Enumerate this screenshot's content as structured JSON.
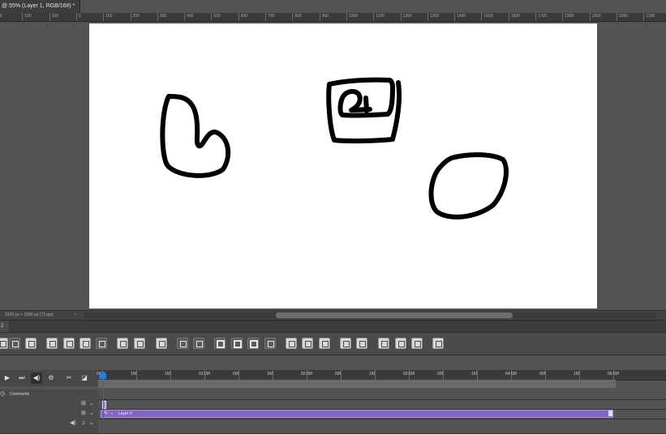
{
  "document_tab": {
    "title": "@ 55% (Layer 1, RGB/16#) *",
    "close_glyph": "×"
  },
  "ruler_top": {
    "labels": [
      "50",
      "100",
      "150",
      "0",
      "100",
      "200",
      "300",
      "400",
      "500",
      "600",
      "700",
      "800",
      "900",
      "1000",
      "1100",
      "1200",
      "1300",
      "1400",
      "1500",
      "1600",
      "1700",
      "1800",
      "1900",
      "2000",
      "2100"
    ]
  },
  "status_bar": {
    "text": "1920 px × 1080 px (72 ppi)",
    "arrow": "›"
  },
  "panel": {
    "tab_label": "2"
  },
  "toolbar3d": {
    "buttons": [
      "scene",
      "grid",
      "save",
      "delete",
      "new-mesh",
      "extrude",
      "wrap",
      "object",
      "bake",
      "fit-width",
      "fit-height",
      "red-channel",
      "green-channel",
      "blue-channel",
      "diagonal",
      "merge",
      "split",
      "align",
      "panel-left",
      "panel-right",
      "notes",
      "notes-2",
      "notes-3",
      "lock"
    ],
    "channel_colors": {
      "red": "#d9373b",
      "green": "#2fa83b",
      "blue": "#3a54d6"
    }
  },
  "transport": {
    "play_icon": "▶",
    "next_icon": "⏭",
    "audio_icon": "◀)",
    "settings_icon": "⚙",
    "split_icon": "✂",
    "transition_icon": "◪"
  },
  "timeline": {
    "time_labels": [
      "00",
      "15f",
      "16f",
      "01:00f",
      "00f",
      "16f",
      "02:00f",
      "00f",
      "16f",
      "03:00f",
      "00f",
      "16f",
      "04:00f",
      "00f",
      "16f",
      "05:00f"
    ],
    "playhead_color": "#c8323a",
    "layer_color": "#8466c0"
  },
  "rows": {
    "comments_label": "Comments",
    "layer_label": "Layer 0",
    "clock_icon": "◷",
    "grid_icon": "⊞",
    "audio_icon": "◀)",
    "music_icon": "♫",
    "chevron": "⌄"
  }
}
